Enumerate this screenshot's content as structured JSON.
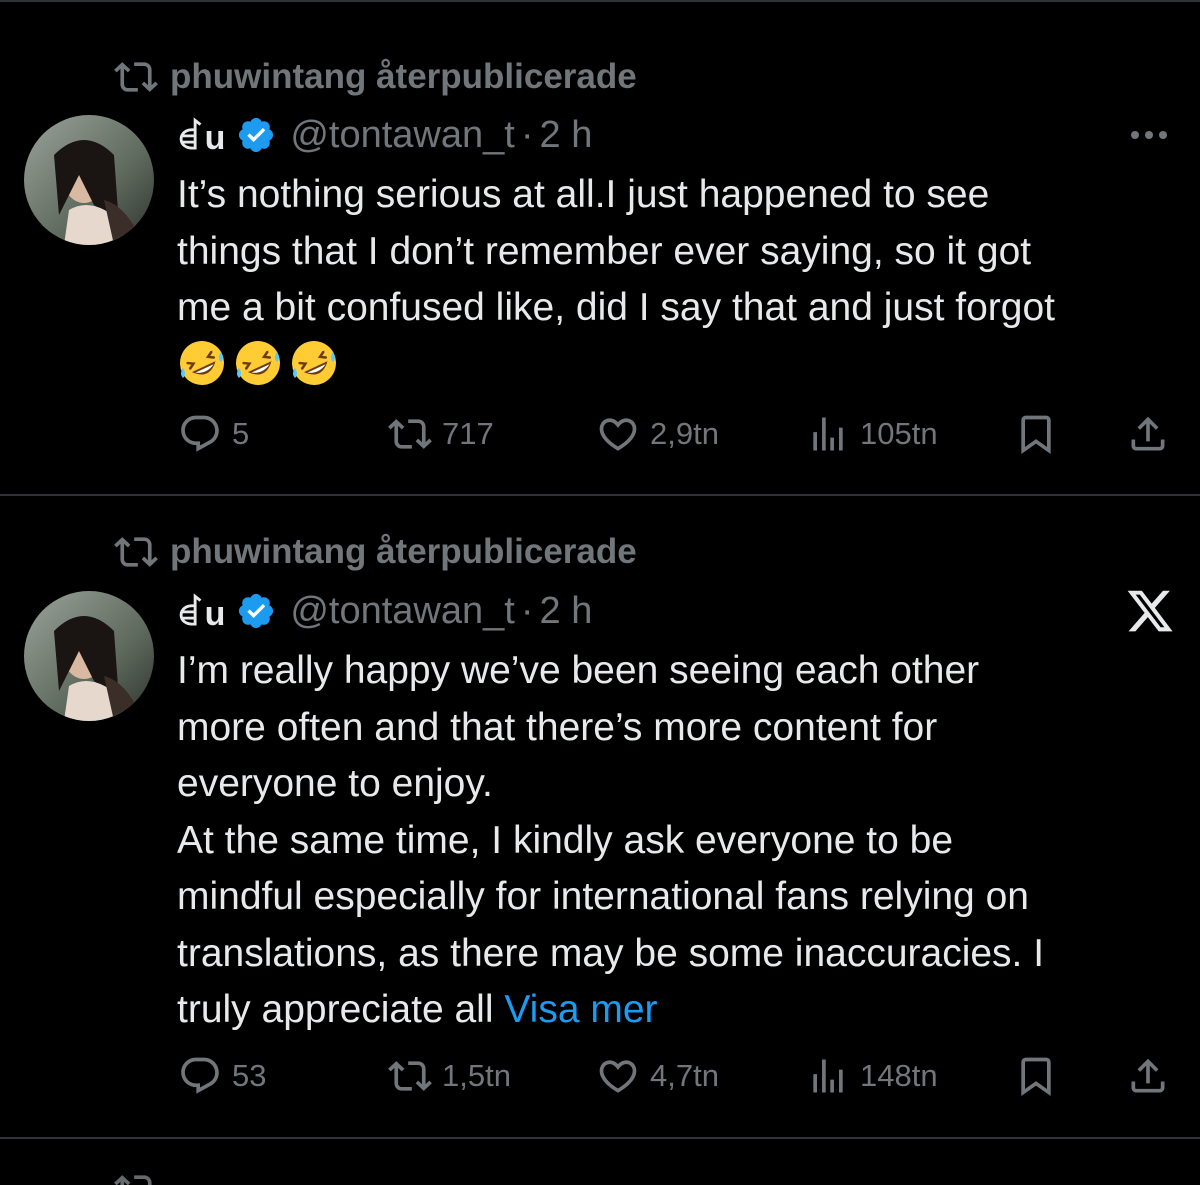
{
  "tweets": [
    {
      "repost_text": "phuwintang återpublicerade",
      "author_name": "ꀸu",
      "handle": "@tontawan_t",
      "separator": "·",
      "time": "2 h",
      "body": "It’s nothing serious at all.I just happened to see\nthings that I don’t remember ever saying, so it got\nme a bit confused like, did I say that and just forgot",
      "emojis": [
        "rolling-on-floor-laughing",
        "rolling-on-floor-laughing",
        "rolling-on-floor-laughing"
      ],
      "replies": "5",
      "reposts": "717",
      "likes": "2,9tn",
      "views": "105tn"
    },
    {
      "repost_text": "phuwintang återpublicerade",
      "author_name": "ꀸu",
      "handle": "@tontawan_t",
      "separator": "·",
      "time": "2 h",
      "body": "I’m really happy we’ve been seeing each other\nmore often and that there’s more content for\neveryone to enjoy.\nAt the same time, I kindly ask everyone to be\nmindful especially for international fans relying on\ntranslations, as there may be some inaccuracies. I\ntruly appreciate all ",
      "show_more": "Visa mer",
      "replies": "53",
      "reposts": "1,5tn",
      "likes": "4,7tn",
      "views": "148tn"
    }
  ],
  "colors": {
    "background": "#000000",
    "text": "#e7e9ea",
    "muted": "#71767b",
    "accent": "#1d9bf0",
    "divider": "#2f3336"
  }
}
